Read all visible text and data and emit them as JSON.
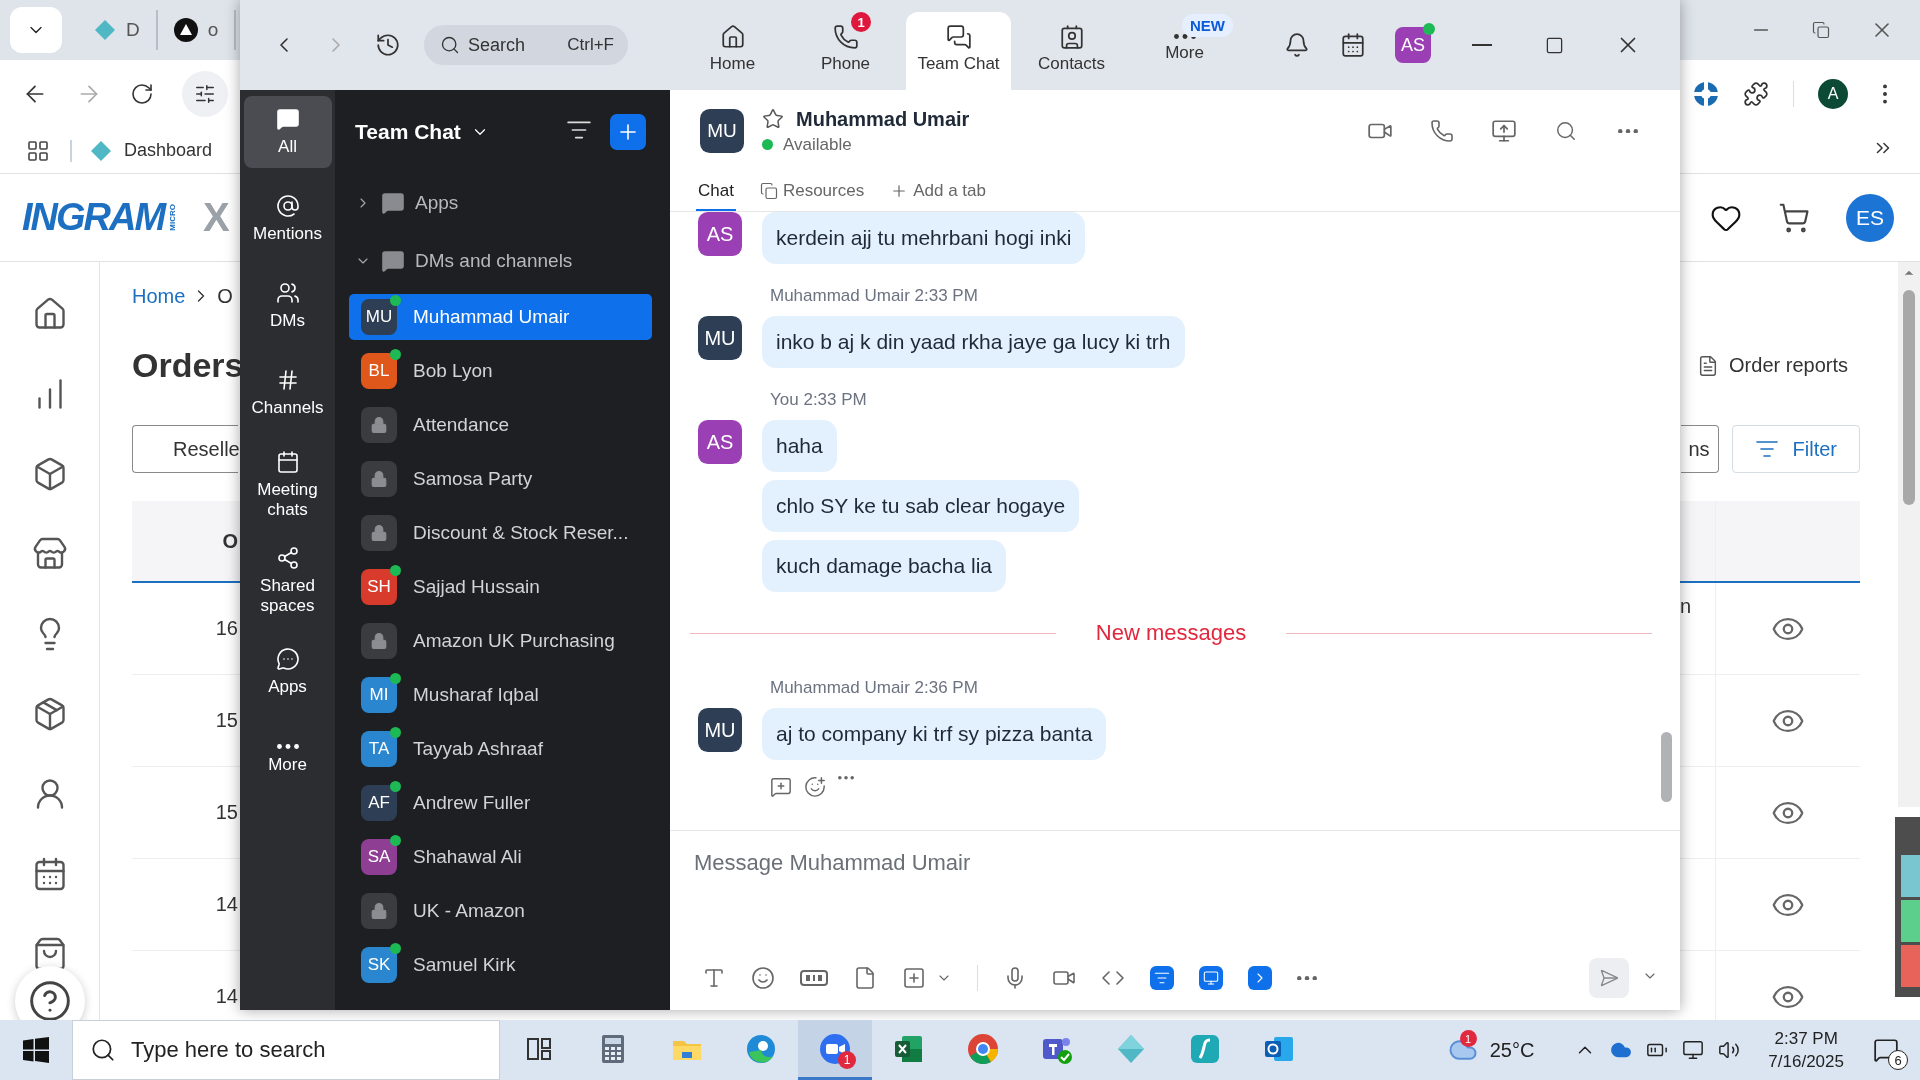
{
  "browser": {
    "tabs": [
      {
        "label": "D",
        "kind": "diamond"
      },
      {
        "label": "o",
        "kind": "dark"
      }
    ],
    "bookmarks": [
      {
        "label": "Dashboard"
      }
    ],
    "profile": "A",
    "logo": {
      "name": "INGRAM",
      "sub": "MICRO",
      "tail": "X"
    },
    "user": "ES",
    "breadcrumb": [
      "Home",
      "O"
    ],
    "title": "Orders",
    "order_reports": "Order reports",
    "buttons": [
      {
        "label": "Reselle",
        "kind": "plain"
      },
      {
        "label": "ns",
        "kind": "plain"
      },
      {
        "label": "Filter",
        "kind": "filter"
      }
    ],
    "table": {
      "header": "O",
      "rows": [
        {
          "column_1": "16",
          "column_2": "n"
        },
        {
          "column_1": "15"
        },
        {
          "column_1": "15"
        },
        {
          "column_1": "14"
        },
        {
          "column_1": "14"
        }
      ]
    }
  },
  "zoom": {
    "search": {
      "placeholder": "Search",
      "shortcut": "Ctrl+F"
    },
    "nav": [
      {
        "label": "Home",
        "kind": "home",
        "selected": false
      },
      {
        "label": "Phone",
        "kind": "phone",
        "badge": "1",
        "selected": false
      },
      {
        "label": "Team Chat",
        "kind": "chat",
        "selected": true
      },
      {
        "label": "Contacts",
        "kind": "contacts",
        "selected": false
      },
      {
        "label": "More",
        "kind": "more",
        "badge": "NEW",
        "selected": false
      }
    ],
    "user": {
      "initials": "AS",
      "color": "#9b3fb5",
      "online": true
    },
    "rail": [
      {
        "label": "All",
        "kind": "all",
        "selected": true
      },
      {
        "label": "Mentions",
        "kind": "mentions",
        "selected": false
      },
      {
        "label": "DMs",
        "kind": "dms",
        "selected": false
      },
      {
        "label": "Channels",
        "kind": "channels",
        "selected": false
      },
      {
        "label": "Meeting chats",
        "kind": "meetings",
        "selected": false
      },
      {
        "label": "Shared spaces",
        "kind": "shared",
        "selected": false
      },
      {
        "label": "Apps",
        "kind": "apps",
        "selected": false
      },
      {
        "label": "More",
        "kind": "more",
        "selected": false
      }
    ],
    "list_title": "Team Chat",
    "sections": [
      {
        "label": "Apps",
        "expanded": false
      },
      {
        "label": "DMs and channels",
        "expanded": true
      }
    ],
    "conversations": [
      {
        "name": "Muhammad Umair",
        "kind": "person",
        "initials": "MU",
        "color": "#2d3e55",
        "online": true,
        "selected": true
      },
      {
        "name": "Bob Lyon",
        "kind": "person",
        "initials": "BL",
        "color": "#e0571c",
        "online": true,
        "selected": false
      },
      {
        "name": "Attendance",
        "kind": "channel",
        "selected": false
      },
      {
        "name": "Samosa Party",
        "kind": "channel",
        "selected": false
      },
      {
        "name": "Discount & Stock Reser...",
        "kind": "channel",
        "selected": false
      },
      {
        "name": "Sajjad Hussain",
        "kind": "person",
        "initials": "SH",
        "color": "#d83b2b",
        "online": true,
        "selected": false
      },
      {
        "name": "Amazon UK Purchasing",
        "kind": "channel",
        "selected": false
      },
      {
        "name": "Musharaf Iqbal",
        "kind": "person",
        "initials": "MI",
        "color": "#2a86cf",
        "online": true,
        "selected": false
      },
      {
        "name": "Tayyab Ashraaf",
        "kind": "person",
        "initials": "TA",
        "color": "#2a86cf",
        "online": true,
        "selected": false
      },
      {
        "name": "Andrew Fuller",
        "kind": "person",
        "initials": "AF",
        "color": "#2d3e55",
        "online": true,
        "selected": false
      },
      {
        "name": "Shahawal Ali",
        "kind": "person",
        "initials": "SA",
        "color": "#8e3e93",
        "online": true,
        "selected": false
      },
      {
        "name": "UK - Amazon",
        "kind": "channel",
        "selected": false
      },
      {
        "name": "Samuel Kirk",
        "kind": "person",
        "initials": "SK",
        "color": "#2a86cf",
        "online": true,
        "selected": false
      }
    ],
    "chat": {
      "initials": "MU",
      "name": "Muhammad Umair",
      "status": "Available",
      "tabs": [
        {
          "label": "Chat",
          "kind": "chat",
          "selected": true
        },
        {
          "label": "Resources",
          "kind": "resources",
          "selected": false
        },
        {
          "label": "Add a tab",
          "kind": "add",
          "selected": false
        }
      ],
      "messages": [
        {
          "kind": "group",
          "initials": "AS",
          "color": "#9b3fb5",
          "bubbles": [
            "kerdein ajj tu mehrbani hogi inki"
          ]
        },
        {
          "kind": "group",
          "initials": "MU",
          "color": "#2d3e55",
          "sender": "Muhammad Umair",
          "time": "2:33 PM",
          "bubbles": [
            "inko b aj k din yaad rkha jaye ga lucy ki trh"
          ]
        },
        {
          "kind": "group",
          "initials": "AS",
          "color": "#9b3fb5",
          "sender": "You",
          "time": "2:33 PM",
          "bubbles": [
            "haha",
            "chlo SY ke tu sab clear hogaye",
            "kuch damage bacha lia"
          ]
        },
        {
          "kind": "divider",
          "label": "New messages"
        },
        {
          "kind": "group",
          "initials": "MU",
          "color": "#2d3e55",
          "sender": "Muhammad Umair",
          "time": "2:36 PM",
          "bubbles": [
            "aj to company ki trf sy pizza banta"
          ],
          "actions": true
        }
      ],
      "composer": {
        "placeholder": "Message Muhammad Umair"
      }
    }
  },
  "taskbar": {
    "search": {
      "placeholder": "Type here to search"
    },
    "apps": [
      {
        "kind": "taskview",
        "selected": false
      },
      {
        "kind": "calculator",
        "selected": false
      },
      {
        "kind": "folder",
        "selected": false
      },
      {
        "kind": "edge",
        "selected": false
      },
      {
        "kind": "zoom",
        "badge": "1",
        "selected": true
      },
      {
        "kind": "excel",
        "selected": false
      },
      {
        "kind": "chrome",
        "selected": false
      },
      {
        "kind": "teams",
        "selected": false
      },
      {
        "kind": "diamond",
        "selected": false
      },
      {
        "kind": "wave",
        "selected": false
      },
      {
        "kind": "outlook",
        "selected": false
      }
    ],
    "weather": {
      "badge": "1",
      "temperature": "25°C"
    },
    "time": "2:37 PM",
    "date": "7/16/2025",
    "notifications": "6"
  }
}
